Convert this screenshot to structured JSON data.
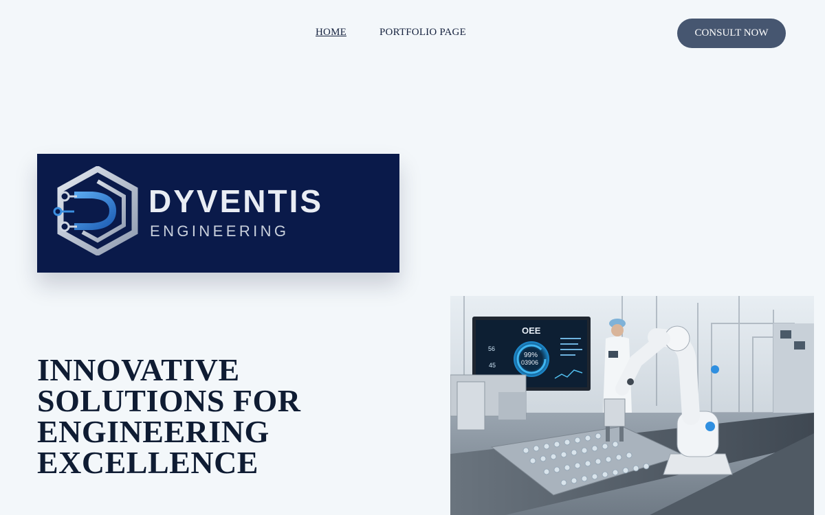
{
  "nav": {
    "links": [
      {
        "label": "HOME",
        "active": true
      },
      {
        "label": "PORTFOLIO PAGE",
        "active": false
      }
    ],
    "cta_label": "CONSULT NOW"
  },
  "logo": {
    "name": "DYVENTIS",
    "subtitle": "ENGINEERING"
  },
  "hero": {
    "headline": "INNOVATIVE SOLUTIONS FOR ENGINEERING EXCELLENCE",
    "image": {
      "monitor_title": "OEE",
      "monitor_value_1": "99%",
      "monitor_value_2": "03906",
      "monitor_side_1": "56",
      "monitor_side_2": "45"
    }
  },
  "colors": {
    "background": "#f3f7fa",
    "text": "#0f1c33",
    "cta": "#465670",
    "logo_bg": "#0a1a4a",
    "logo_accent": "#3b8fe0"
  }
}
